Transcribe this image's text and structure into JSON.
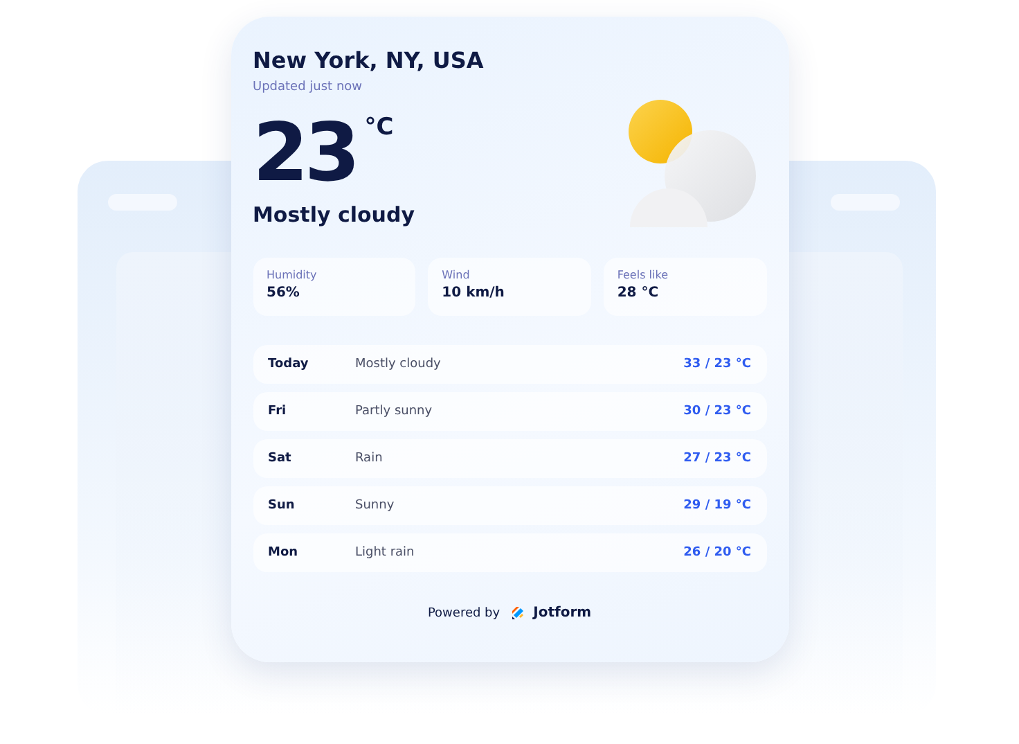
{
  "location": "New York, NY, USA",
  "updated": "Updated just now",
  "temperature": "23",
  "unit": "°C",
  "condition": "Mostly cloudy",
  "stats": [
    {
      "label": "Humidity",
      "value": "56%"
    },
    {
      "label": "Wind",
      "value": "10 km/h"
    },
    {
      "label": "Feels like",
      "value": "28 °C"
    }
  ],
  "forecast": [
    {
      "day": "Today",
      "condition": "Mostly cloudy",
      "range": "33 / 23 °C"
    },
    {
      "day": "Fri",
      "condition": "Partly sunny",
      "range": "30 / 23 °C"
    },
    {
      "day": "Sat",
      "condition": "Rain",
      "range": "27 / 23 °C"
    },
    {
      "day": "Sun",
      "condition": "Sunny",
      "range": "29 / 19 °C"
    },
    {
      "day": "Mon",
      "condition": "Light rain",
      "range": "26 / 20 °C"
    }
  ],
  "footer": {
    "powered_by": "Powered by",
    "brand": "Jotform"
  }
}
